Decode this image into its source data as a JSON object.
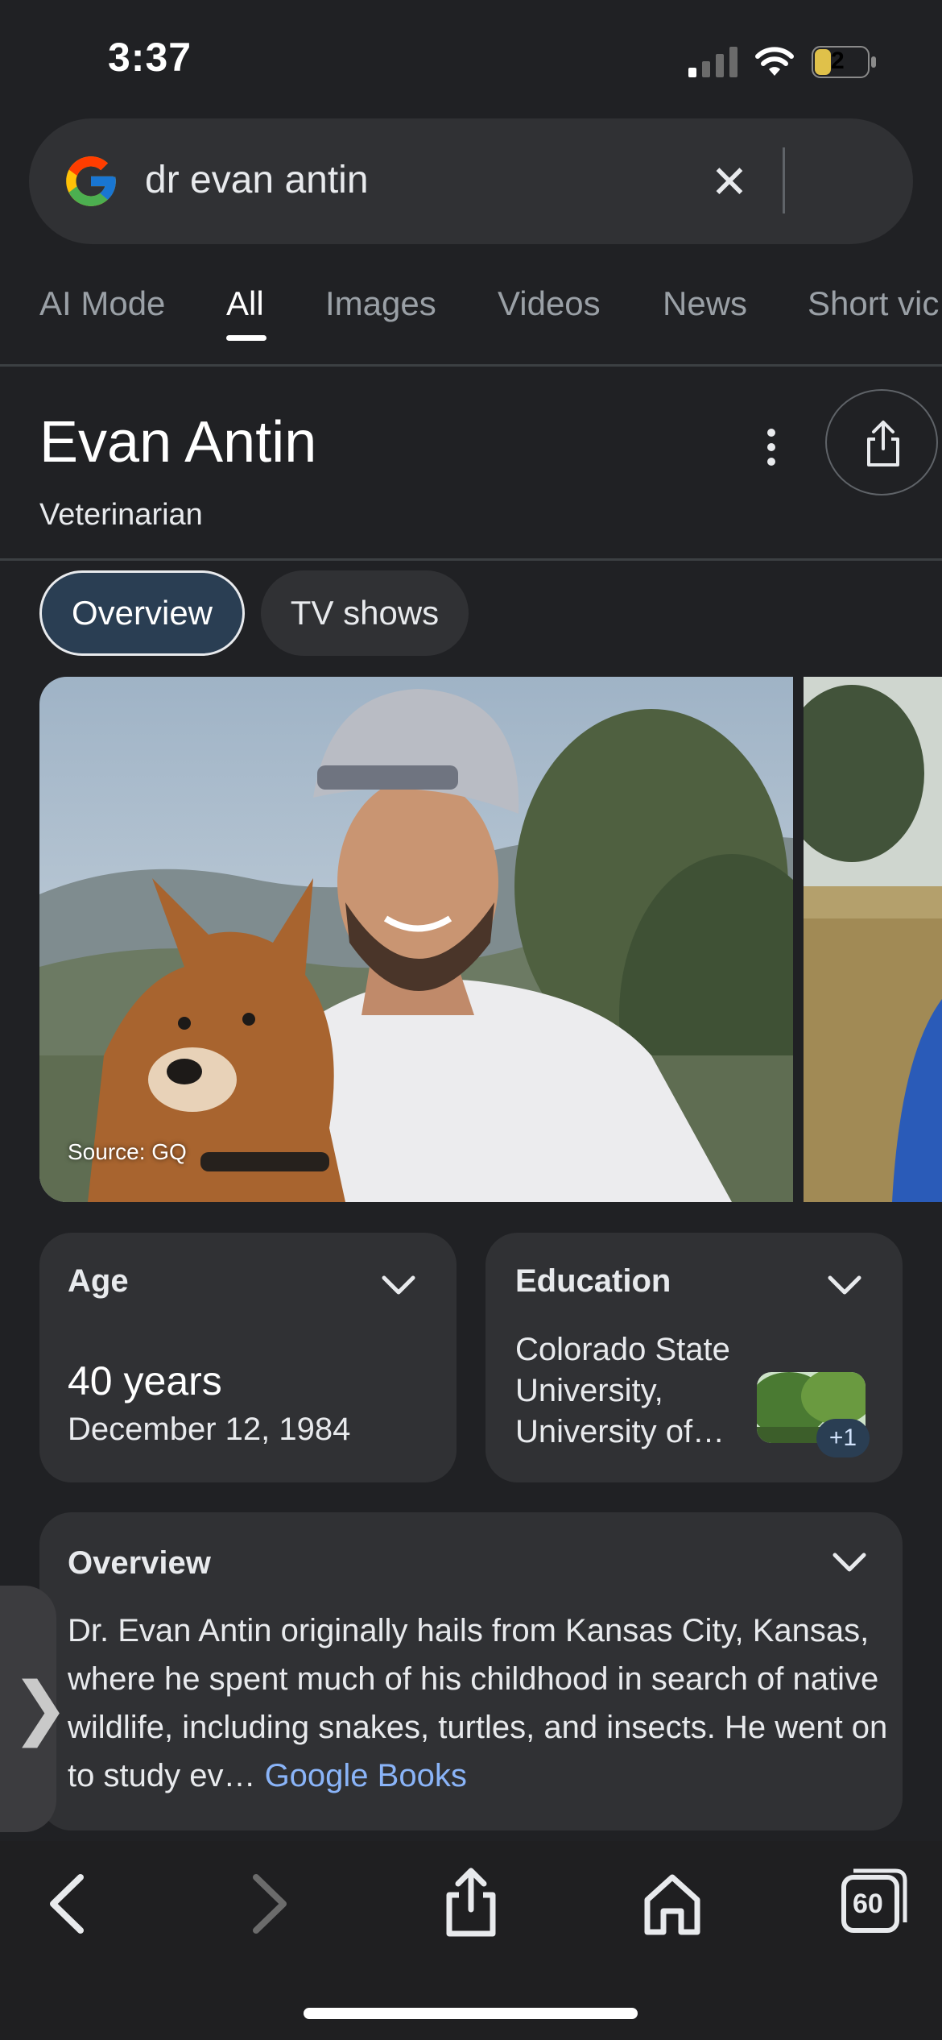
{
  "status": {
    "time": "3:37",
    "battery": "2"
  },
  "search": {
    "query": "dr evan antin"
  },
  "tabs": [
    {
      "label": "AI Mode"
    },
    {
      "label": "All"
    },
    {
      "label": "Images"
    },
    {
      "label": "Videos"
    },
    {
      "label": "News"
    },
    {
      "label": "Short vic"
    }
  ],
  "panel": {
    "title": "Evan Antin",
    "subtitle": "Veterinarian",
    "chips": [
      "Overview",
      "TV shows"
    ],
    "image_source": "Source: GQ"
  },
  "age_card": {
    "label": "Age",
    "value": "40 years",
    "date": "December 12, 1984"
  },
  "education_card": {
    "label": "Education",
    "text": "Colorado State University, University of…",
    "badge": "+1"
  },
  "overview_card": {
    "label": "Overview",
    "text": "Dr. Evan Antin originally hails from Kansas City, Kansas, where he spent much of his childhood in search of native wildlife, including snakes, turtles, and insects. He went on to study ev",
    "ellipsis": "…",
    "link": "Google Books"
  },
  "toolbar": {
    "tabs_count": "60"
  },
  "colors": {
    "background": "#202124",
    "surface": "#303134",
    "accent_link": "#8ab4f8",
    "chip_selected": "#2a3e53"
  }
}
